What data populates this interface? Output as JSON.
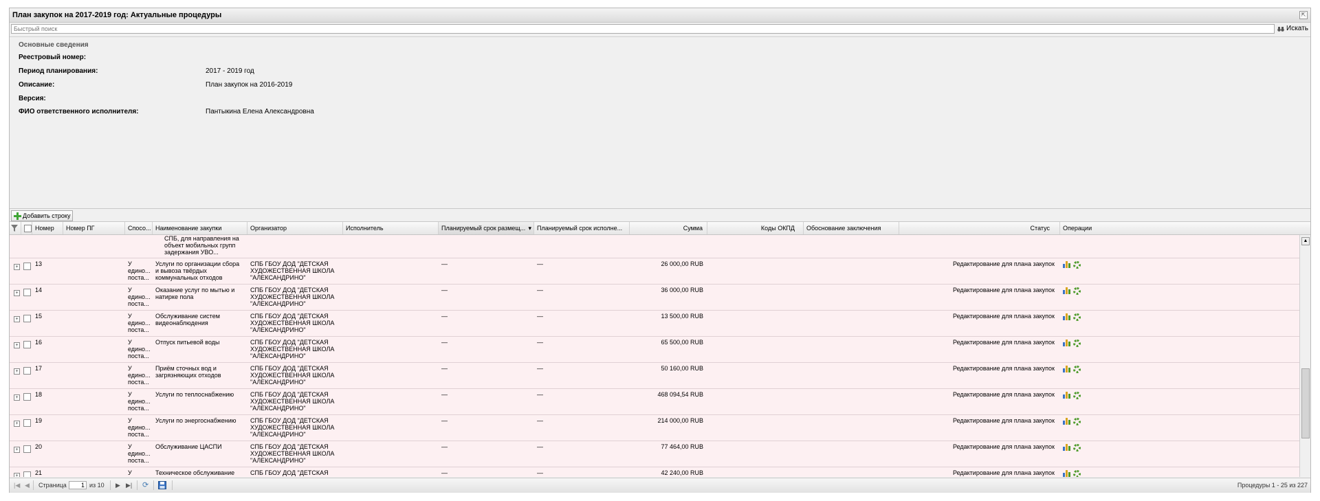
{
  "window": {
    "title": "План закупок на 2017-2019 год: Актуальные процедуры"
  },
  "search": {
    "placeholder": "Быстрый поиск",
    "button_label": "Искать"
  },
  "info": {
    "legend": "Основные сведения",
    "fields": [
      {
        "label": "Реестровый номер:",
        "value": ""
      },
      {
        "label": "Период планирования:",
        "value": "2017 - 2019 год"
      },
      {
        "label": "Описание:",
        "value": "План закупок на 2016-2019"
      },
      {
        "label": "Версия:",
        "value": ""
      },
      {
        "label": "ФИО ответственного исполнителя:",
        "value": "Пантыкина Елена Александровна"
      }
    ]
  },
  "toolbar": {
    "add_row_label": "Добавить строку"
  },
  "grid": {
    "columns": [
      "Номер",
      "Номер ПГ",
      "Спосо...",
      "Наименование закупки",
      "Организатор",
      "Исполнитель",
      "Планируемый срок размещ...",
      "Планируемый срок исполне...",
      "Сумма",
      "Коды ОКПД",
      "Обоснование заключения",
      "Статус",
      "Операции"
    ],
    "partial_row_text": "СПБ, для направления на\nобъект мобильных групп\nзадержания УВО...",
    "rows": [
      {
        "num": "13",
        "method": "У\nедино...\nпоста...",
        "name": "Услуги по организации сбора\nи вывоза твёрдых\nкоммунальных отходов",
        "org": "СПБ ГБОУ ДОД \"ДЕТСКАЯ\nХУДОЖЕСТВЕННАЯ ШКОЛА\n\"АЛЕКСАНДРИНО\"",
        "term1": "—",
        "term2": "—",
        "sum": "26 000,00 RUB",
        "status": "Редактирование для плана закупок"
      },
      {
        "num": "14",
        "method": "У\nедино...\nпоста...",
        "name": "Оказание услуг по мытью и\nнатирке пола",
        "org": "СПБ ГБОУ ДОД \"ДЕТСКАЯ\nХУДОЖЕСТВЕННАЯ ШКОЛА\n\"АЛЕКСАНДРИНО\"",
        "term1": "—",
        "term2": "—",
        "sum": "36 000,00 RUB",
        "status": "Редактирование для плана закупок"
      },
      {
        "num": "15",
        "method": "У\nедино...\nпоста...",
        "name": "Обслуживание систем\nвидеонаблюдения",
        "org": "СПБ ГБОУ ДОД \"ДЕТСКАЯ\nХУДОЖЕСТВЕННАЯ ШКОЛА\n\"АЛЕКСАНДРИНО\"",
        "term1": "—",
        "term2": "—",
        "sum": "13 500,00 RUB",
        "status": "Редактирование для плана закупок"
      },
      {
        "num": "16",
        "method": "У\nедино...\nпоста...",
        "name": "Отпуск питьевой воды",
        "org": "СПБ ГБОУ ДОД \"ДЕТСКАЯ\nХУДОЖЕСТВЕННАЯ ШКОЛА\n\"АЛЕКСАНДРИНО\"",
        "term1": "—",
        "term2": "—",
        "sum": "65 500,00 RUB",
        "status": "Редактирование для плана закупок"
      },
      {
        "num": "17",
        "method": "У\nедино...\nпоста...",
        "name": "Приём сточных вод и\nзагрязняющих отходов",
        "org": "СПБ ГБОУ ДОД \"ДЕТСКАЯ\nХУДОЖЕСТВЕННАЯ ШКОЛА\n\"АЛЕКСАНДРИНО\"",
        "term1": "—",
        "term2": "—",
        "sum": "50 160,00 RUB",
        "status": "Редактирование для плана закупок"
      },
      {
        "num": "18",
        "method": "У\nедино...\nпоста...",
        "name": "Услуги по теплоснабжению",
        "org": "СПБ ГБОУ ДОД \"ДЕТСКАЯ\nХУДОЖЕСТВЕННАЯ ШКОЛА\n\"АЛЕКСАНДРИНО\"",
        "term1": "—",
        "term2": "—",
        "sum": "468 094,54 RUB",
        "status": "Редактирование для плана закупок"
      },
      {
        "num": "19",
        "method": "У\nедино...\nпоста...",
        "name": "Услуги по энергоснабжению",
        "org": "СПБ ГБОУ ДОД \"ДЕТСКАЯ\nХУДОЖЕСТВЕННАЯ ШКОЛА\n\"АЛЕКСАНДРИНО\"",
        "term1": "—",
        "term2": "—",
        "sum": "214 000,00 RUB",
        "status": "Редактирование для плана закупок"
      },
      {
        "num": "20",
        "method": "У\nедино...\nпоста...",
        "name": "Обслуживание ЦАСПИ",
        "org": "СПБ ГБОУ ДОД \"ДЕТСКАЯ\nХУДОЖЕСТВЕННАЯ ШКОЛА\n\"АЛЕКСАНДРИНО\"",
        "term1": "—",
        "term2": "—",
        "sum": "77 464,00 RUB",
        "status": "Редактирование для плана закупок"
      },
      {
        "num": "21",
        "method": "У\nедино...\nпоста...",
        "name": "Техническое обслуживание\nустановки охранно-пожарной",
        "org": "СПБ ГБОУ ДОД \"ДЕТСКАЯ\nХУДОЖЕСТВЕННАЯ ШКОЛА\n\"АЛЕКСАНДРИНО\"",
        "term1": "—",
        "term2": "—",
        "sum": "42 240,00 RUB",
        "status": "Редактирование для плана закупок"
      }
    ]
  },
  "pager": {
    "page_label": "Страница",
    "page_value": "1",
    "of_label": "из 10",
    "summary": "Процедуры 1 - 25 из 227"
  },
  "icons": {
    "add": "plus-icon",
    "search": "binoculars-icon",
    "chart": "chart-icon",
    "gear": "gear-icon",
    "refresh": "refresh-icon",
    "save": "save-icon",
    "filter": "filter-icon"
  },
  "colors": {
    "row_bg": "#fdf0f2",
    "add_green": "#3fa535",
    "save_blue": "#3a73c4"
  }
}
